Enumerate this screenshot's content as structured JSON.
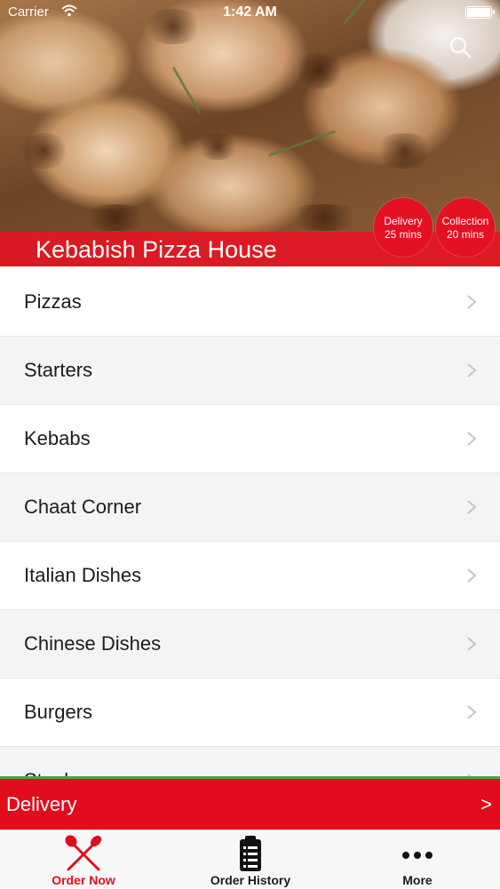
{
  "status_bar": {
    "carrier": "Carrier",
    "time": "1:42 AM"
  },
  "header": {
    "restaurant_name": "Kebabish Pizza House",
    "delivery_badge": {
      "title": "Delivery",
      "time": "25 mins"
    },
    "collection_badge": {
      "title": "Collection",
      "time": "20 mins"
    }
  },
  "categories": [
    {
      "label": "Pizzas"
    },
    {
      "label": "Starters"
    },
    {
      "label": "Kebabs"
    },
    {
      "label": "Chaat Corner"
    },
    {
      "label": "Italian Dishes"
    },
    {
      "label": "Chinese Dishes"
    },
    {
      "label": "Burgers"
    },
    {
      "label": "Steaks"
    }
  ],
  "order_type_bar": {
    "label": "Delivery",
    "arrow": ">"
  },
  "tab_bar": {
    "items": [
      {
        "label": "Order Now",
        "icon": "fork-knife-icon",
        "active": true
      },
      {
        "label": "Order History",
        "icon": "clipboard-icon",
        "active": false
      },
      {
        "label": "More",
        "icon": "more-dots-icon",
        "active": false
      }
    ]
  },
  "colors": {
    "brand_red": "#e10d1d",
    "badge_red": "#e31121",
    "accent_green": "#4aa54a",
    "row_alt": "#f3f4f6"
  }
}
